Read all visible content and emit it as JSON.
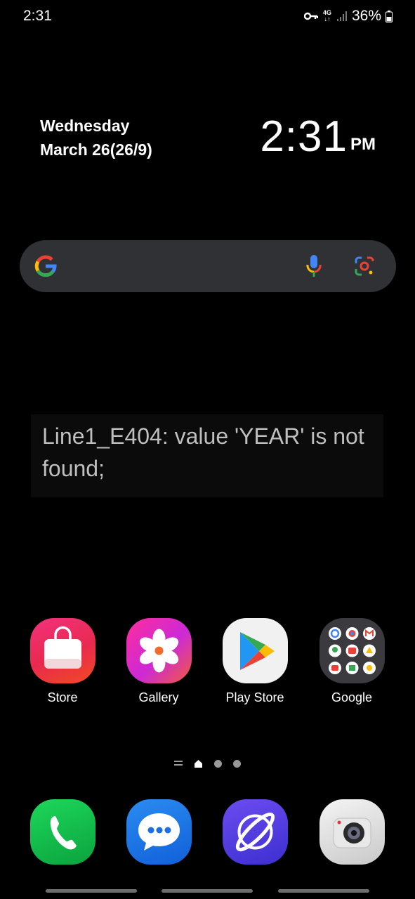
{
  "status_bar": {
    "time": "2:31",
    "network": "4G",
    "battery": "36%"
  },
  "clock_widget": {
    "day": "Wednesday",
    "date": "March 26(26/9)",
    "time": "2:31",
    "ampm": "PM"
  },
  "search_bar": {
    "icons": [
      "google-g-icon",
      "microphone-icon",
      "google-lens-icon"
    ]
  },
  "error_widget": {
    "message": "Line1_E404: value 'YEAR' is not found;"
  },
  "apps": [
    {
      "label": "Store",
      "icon": "shopping-bag-icon"
    },
    {
      "label": "Gallery",
      "icon": "flower-icon"
    },
    {
      "label": "Play Store",
      "icon": "play-triangle-icon"
    },
    {
      "label": "Google",
      "icon": "google-folder-icon"
    }
  ],
  "dock": [
    {
      "icon": "phone-icon"
    },
    {
      "icon": "messages-icon"
    },
    {
      "icon": "internet-icon"
    },
    {
      "icon": "camera-icon"
    }
  ],
  "colors": {
    "background": "#000000",
    "search_bar": "#303134",
    "error_text": "#bfbfbf"
  }
}
